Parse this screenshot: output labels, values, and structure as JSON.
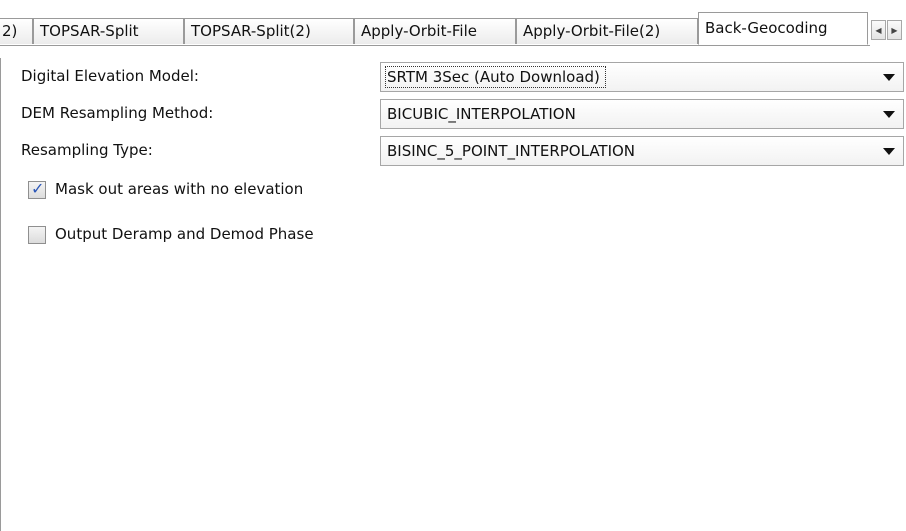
{
  "tabs": [
    {
      "label": "2)"
    },
    {
      "label": "TOPSAR-Split"
    },
    {
      "label": "TOPSAR-Split(2)"
    },
    {
      "label": "Apply-Orbit-File"
    },
    {
      "label": "Apply-Orbit-File(2)"
    },
    {
      "label": "Back-Geocoding",
      "active": true
    }
  ],
  "tab_scroll": {
    "left_icon": "chevron-left-icon",
    "right_icon": "chevron-right-icon"
  },
  "fields": [
    {
      "label": "Digital Elevation Model:",
      "value": "SRTM 3Sec (Auto Download)"
    },
    {
      "label": "DEM Resampling Method:",
      "value": "BICUBIC_INTERPOLATION"
    },
    {
      "label": "Resampling Type:",
      "value": "BISINC_5_POINT_INTERPOLATION"
    }
  ],
  "checkboxes": [
    {
      "label": "Mask out areas with no elevation",
      "checked": true
    },
    {
      "label": "Output Deramp and Demod Phase",
      "checked": false
    }
  ],
  "colors": {
    "check_mark": "#2c57b8",
    "border": "#9a9a9a"
  }
}
